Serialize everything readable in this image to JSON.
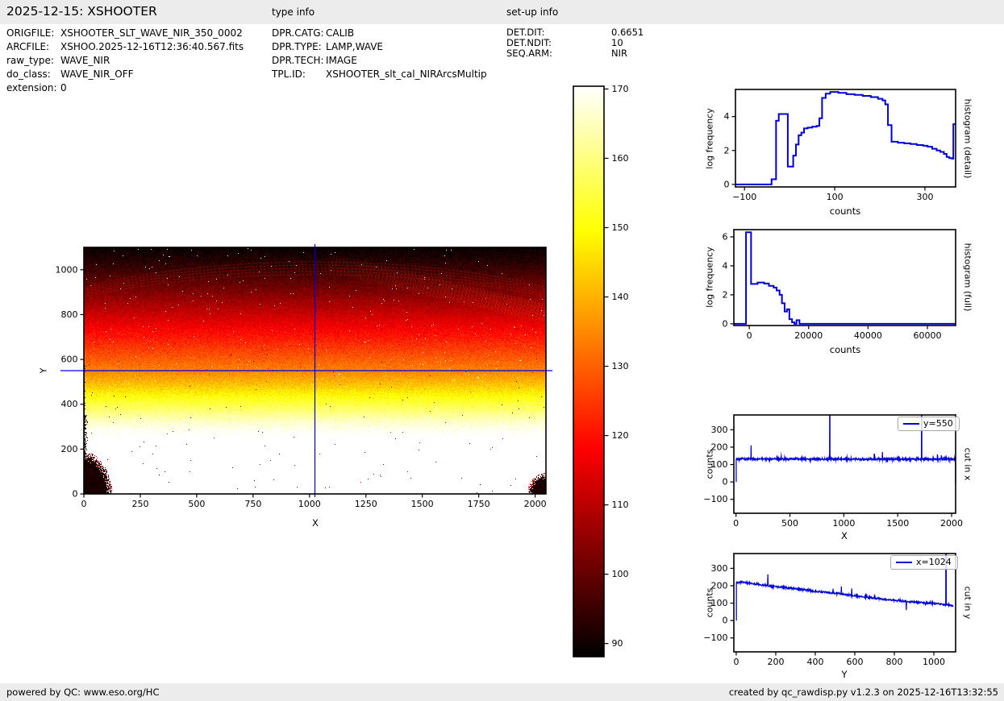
{
  "colors": {
    "bar_bg": "#ececec",
    "line_blue": "#0000dd",
    "text": "#000000"
  },
  "header": {
    "title": "2025-12-15: XSHOOTER",
    "type_info_label": "type info",
    "setup_info_label": "set-up info"
  },
  "metadata": {
    "file_info": [
      {
        "label": "ORIGFILE:",
        "value": "XSHOOTER_SLT_WAVE_NIR_350_0002"
      },
      {
        "label": "ARCFILE:",
        "value": "XSHOO.2025-12-16T12:36:40.567.fits"
      },
      {
        "label": "raw_type:",
        "value": "WAVE_NIR"
      },
      {
        "label": "do_class:",
        "value": "WAVE_NIR_OFF"
      },
      {
        "label": "extension:",
        "value": "0"
      }
    ],
    "type_info": [
      {
        "label": "DPR.CATG:",
        "value": "CALIB"
      },
      {
        "label": "DPR.TYPE:",
        "value": "LAMP,WAVE"
      },
      {
        "label": "DPR.TECH:",
        "value": "IMAGE"
      },
      {
        "label": "TPL.ID:",
        "value": "XSHOOTER_slt_cal_NIRArcsMultip"
      }
    ],
    "setup_info": [
      {
        "label": "DET.DIT:",
        "value": "0.6651"
      },
      {
        "label": "DET.NDIT:",
        "value": "10"
      },
      {
        "label": "SEQ.ARM:",
        "value": "NIR"
      }
    ]
  },
  "footer": {
    "left": "powered by QC: www.eso.org/HC",
    "right": "created by qc_rawdisp.py v1.2.3 on 2025-12-16T13:32:55"
  },
  "chart_data": [
    {
      "id": "main_image",
      "type": "heatmap",
      "xlabel": "X",
      "ylabel": "Y",
      "xlim": [
        0,
        2048
      ],
      "ylim": [
        0,
        1100
      ],
      "xticks": [
        0,
        250,
        500,
        750,
        1000,
        1250,
        1500,
        1750,
        2000
      ],
      "yticks": [
        0,
        200,
        400,
        600,
        800,
        1000
      ],
      "crosshair": {
        "x": 1024,
        "y": 550
      },
      "colormap": "hot",
      "vmin": 88,
      "vmax": 170.4,
      "row_profile": [
        [
          0,
          192
        ],
        [
          200,
          178
        ],
        [
          260,
          172
        ],
        [
          320,
          166
        ],
        [
          400,
          155
        ],
        [
          480,
          143
        ],
        [
          550,
          134
        ],
        [
          640,
          126
        ],
        [
          720,
          119
        ],
        [
          800,
          112
        ],
        [
          900,
          103
        ],
        [
          1000,
          95
        ],
        [
          1100,
          88.5
        ]
      ],
      "noise_sigma": 3.2,
      "fringes": {
        "arc_center_x": 1024,
        "arc_apex_y": [
          1035,
          1021,
          1007,
          993,
          979
        ],
        "arc_rx": 1500,
        "band": {
          "from": [
            1100,
            1025
          ],
          "to": [
            2048,
            805
          ],
          "half_width": 45
        }
      },
      "seed": 5
    },
    {
      "id": "colorbar",
      "type": "colorbar",
      "colormap": "hot",
      "vmin": 88.1,
      "vmax": 170.4,
      "ticks": [
        90,
        100,
        110,
        120,
        130,
        140,
        150,
        160,
        170
      ]
    },
    {
      "id": "hist_detail",
      "type": "step",
      "side_label": "histogram (detail)",
      "xlabel": "counts",
      "ylabel": "log frequency",
      "xlim": [
        -120,
        368
      ],
      "ylim": [
        -0.15,
        5.6
      ],
      "xticks": [
        -100,
        100,
        300
      ],
      "yticks": [
        0,
        2,
        4
      ],
      "steps": [
        [
          -120,
          0
        ],
        [
          -40,
          0.3
        ],
        [
          -30,
          3.75
        ],
        [
          -24,
          4.15
        ],
        [
          -4,
          1.05
        ],
        [
          8,
          1.7
        ],
        [
          14,
          2.35
        ],
        [
          20,
          2.9
        ],
        [
          26,
          3.05
        ],
        [
          32,
          3.3
        ],
        [
          40,
          3.35
        ],
        [
          50,
          3.4
        ],
        [
          60,
          3.45
        ],
        [
          66,
          3.9
        ],
        [
          72,
          5.1
        ],
        [
          80,
          5.35
        ],
        [
          90,
          5.45
        ],
        [
          108,
          5.4
        ],
        [
          126,
          5.32
        ],
        [
          144,
          5.28
        ],
        [
          162,
          5.22
        ],
        [
          180,
          5.15
        ],
        [
          196,
          5.05
        ],
        [
          206,
          4.95
        ],
        [
          212,
          4.72
        ],
        [
          218,
          3.5
        ],
        [
          226,
          2.52
        ],
        [
          240,
          2.46
        ],
        [
          254,
          2.42
        ],
        [
          268,
          2.38
        ],
        [
          282,
          2.32
        ],
        [
          296,
          2.28
        ],
        [
          306,
          2.22
        ],
        [
          316,
          2.1
        ],
        [
          326,
          2.0
        ],
        [
          334,
          1.92
        ],
        [
          342,
          1.8
        ],
        [
          348,
          1.62
        ],
        [
          354,
          1.55
        ],
        [
          360,
          1.52
        ],
        [
          363,
          3.55
        ],
        [
          368,
          3.55
        ]
      ]
    },
    {
      "id": "hist_full",
      "type": "step",
      "side_label": "histogram (full)",
      "xlabel": "counts",
      "ylabel": "log frequency",
      "xlim": [
        -5200,
        69500
      ],
      "ylim": [
        -0.12,
        6.5
      ],
      "xticks": [
        0,
        20000,
        40000,
        60000
      ],
      "yticks": [
        0,
        2,
        4,
        6
      ],
      "steps": [
        [
          -5200,
          0
        ],
        [
          -1100,
          6.32
        ],
        [
          600,
          2.75
        ],
        [
          2800,
          2.85
        ],
        [
          5000,
          2.78
        ],
        [
          6600,
          2.62
        ],
        [
          8200,
          2.5
        ],
        [
          9200,
          2.3
        ],
        [
          10200,
          2.0
        ],
        [
          11000,
          1.42
        ],
        [
          11900,
          0.85
        ],
        [
          12700,
          1.0
        ],
        [
          13500,
          0.32
        ],
        [
          14400,
          0.1
        ],
        [
          15200,
          0
        ],
        [
          15900,
          0.25
        ],
        [
          16900,
          0
        ],
        [
          69500,
          0
        ]
      ]
    },
    {
      "id": "cut_x",
      "type": "cut",
      "legend": "y=550",
      "side_label": "cut in x",
      "xlabel": "X",
      "ylabel": "counts",
      "xlim": [
        -20,
        2037
      ],
      "ylim": [
        -180,
        385
      ],
      "xticks": [
        0,
        500,
        1000,
        1500,
        2000
      ],
      "yticks": [
        -100,
        0,
        100,
        200,
        300
      ],
      "series": {
        "x_start": 2,
        "x_end": 2036,
        "sample_step": 2,
        "base_profile": [
          [
            0,
            132
          ],
          [
            2036,
            131
          ]
        ],
        "noise": 4.2,
        "rise_from_zero": true,
        "end_drop_to": -8,
        "spikes": [
          [
            140,
            210
          ],
          [
            380,
            152
          ],
          [
            420,
            148
          ],
          [
            640,
            147
          ],
          [
            870,
            920
          ],
          [
            1283,
            160
          ],
          [
            1358,
            172
          ],
          [
            1510,
            150
          ],
          [
            1722,
            920
          ],
          [
            1868,
            158
          ],
          [
            1905,
            150
          ]
        ],
        "seed": 7
      }
    },
    {
      "id": "cut_y",
      "type": "cut",
      "legend": "x=1024",
      "side_label": "cut in y",
      "xlabel": "Y",
      "ylabel": "counts",
      "xlim": [
        -12,
        1110
      ],
      "ylim": [
        -180,
        385
      ],
      "xticks": [
        0,
        200,
        400,
        600,
        800,
        1000
      ],
      "yticks": [
        -100,
        0,
        100,
        200,
        300
      ],
      "series": {
        "x_start": 1,
        "x_end": 1100,
        "sample_step": 1.5,
        "base_profile": [
          [
            0,
            218
          ],
          [
            30,
            222
          ],
          [
            100,
            209
          ],
          [
            200,
            196
          ],
          [
            300,
            183
          ],
          [
            400,
            168
          ],
          [
            500,
            157
          ],
          [
            600,
            142
          ],
          [
            700,
            128
          ],
          [
            800,
            116
          ],
          [
            860,
            110
          ],
          [
            900,
            106
          ],
          [
            1000,
            98
          ],
          [
            1100,
            86
          ]
        ],
        "noise": 4.5,
        "rise_from_zero": true,
        "spikes": [
          [
            160,
            265
          ],
          [
            490,
            183
          ],
          [
            532,
            196
          ],
          [
            585,
            184
          ],
          [
            660,
            152
          ],
          [
            700,
            150
          ],
          [
            860,
            60
          ],
          [
            1062,
            920
          ]
        ],
        "seed": 11
      }
    }
  ]
}
